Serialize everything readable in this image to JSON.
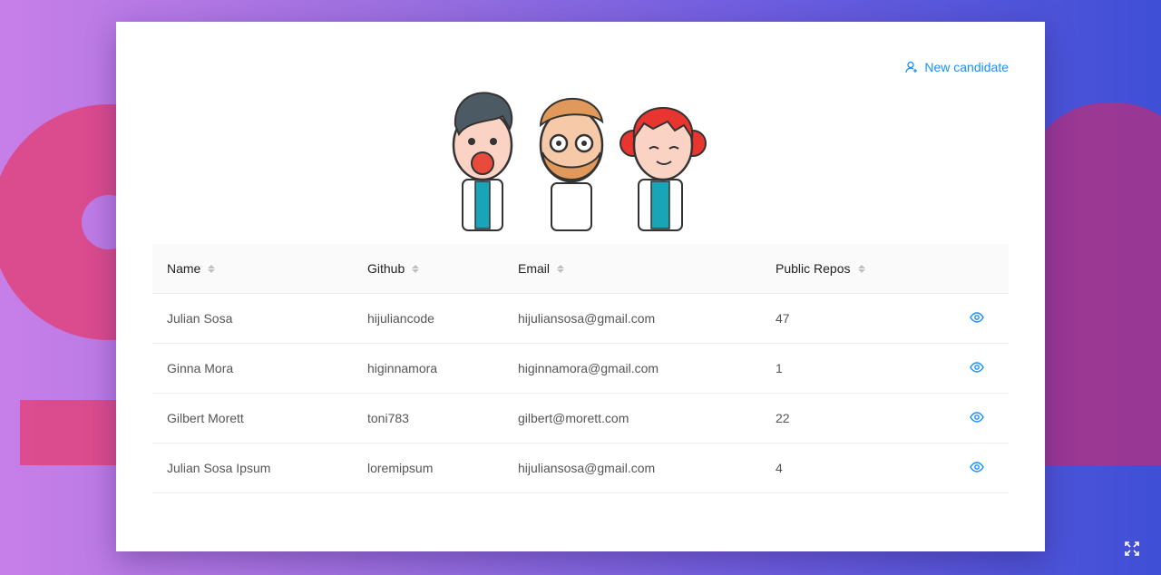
{
  "header": {
    "new_candidate_label": "New candidate"
  },
  "table": {
    "columns": [
      "Name",
      "Github",
      "Email",
      "Public Repos"
    ],
    "rows": [
      {
        "name": "Julian Sosa",
        "github": "hijuliancode",
        "email": "hijuliansosa@gmail.com",
        "repos": "47"
      },
      {
        "name": "Ginna Mora",
        "github": "higinnamora",
        "email": "higinnamora@gmail.com",
        "repos": "1"
      },
      {
        "name": "Gilbert Morett",
        "github": "toni783",
        "email": "gilbert@morett.com",
        "repos": "22"
      },
      {
        "name": "Julian Sosa Ipsum",
        "github": "loremipsum",
        "email": "hijuliansosa@gmail.com",
        "repos": "4"
      }
    ]
  },
  "icons": {
    "new_candidate": "user-add-icon",
    "row_action": "eye-icon",
    "fullscreen": "expand-icon"
  },
  "colors": {
    "accent": "#1890ff",
    "bg_pink": "#dd4887",
    "bg_purple": "#a3358d"
  }
}
